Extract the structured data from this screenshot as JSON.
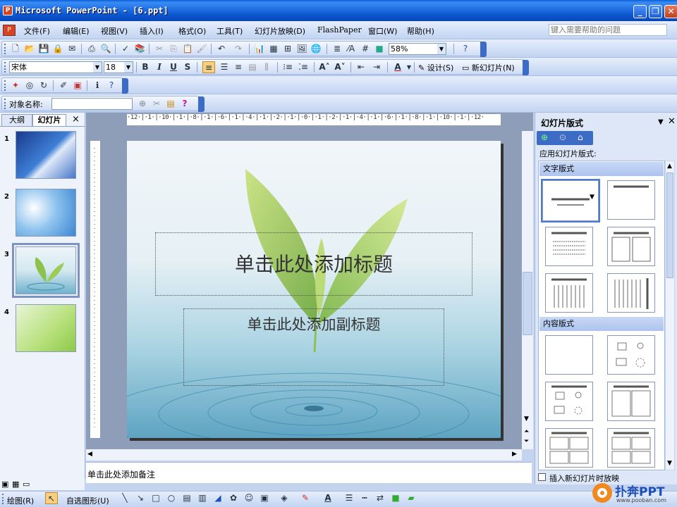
{
  "window": {
    "title": "Microsoft PowerPoint - [6.ppt]",
    "min": "_",
    "max": "❐",
    "close": "✕"
  },
  "menu": {
    "items": [
      "文件(F)",
      "编辑(E)",
      "视图(V)",
      "插入(I)",
      "格式(O)",
      "工具(T)",
      "幻灯片放映(D)",
      "FlashPaper",
      "窗口(W)",
      "帮助(H)"
    ],
    "help_placeholder": "键入需要帮助的问题"
  },
  "standard": {
    "zoom": "58%"
  },
  "formatting": {
    "font": "宋体",
    "size": "18",
    "bold": "B",
    "italic": "I",
    "underline": "U",
    "shadow": "S",
    "design": "设计(S)",
    "new_slide": "新幻灯片(N)"
  },
  "objectbar": {
    "label": "对象名称:"
  },
  "leftpanel": {
    "tabs": [
      "大纲",
      "幻灯片"
    ],
    "close": "×",
    "slides": [
      "1",
      "2",
      "3",
      "4"
    ]
  },
  "slide": {
    "title_placeholder": "单击此处添加标题",
    "subtitle_placeholder": "单击此处添加副标题"
  },
  "ruler": {
    "h": "·12·|·1·|·10·|·1·|·8·|·1·|·6·|·1·|·4·|·1·|·2·|·1·|·0·|·1·|·2·|·1·|·4·|·1·|·6·|·1·|·8·|·1·|·10·|·1·|·12·"
  },
  "notes": {
    "placeholder": "单击此处添加备注"
  },
  "taskpane": {
    "title": "幻灯片版式",
    "apply_label": "应用幻灯片版式:",
    "text_section": "文字版式",
    "content_section": "内容版式",
    "checkbox_label": "插入新幻灯片时放映"
  },
  "drawbar": {
    "draw": "绘图(R)",
    "autoshapes": "自选图形(U)"
  },
  "logo": {
    "text": "扑奔PPT",
    "url": "www.pooban.com"
  },
  "colors": {
    "accent": "#0b57d0",
    "toolbar": "#c2d4f2",
    "slidebg": "#e6f0f5"
  }
}
